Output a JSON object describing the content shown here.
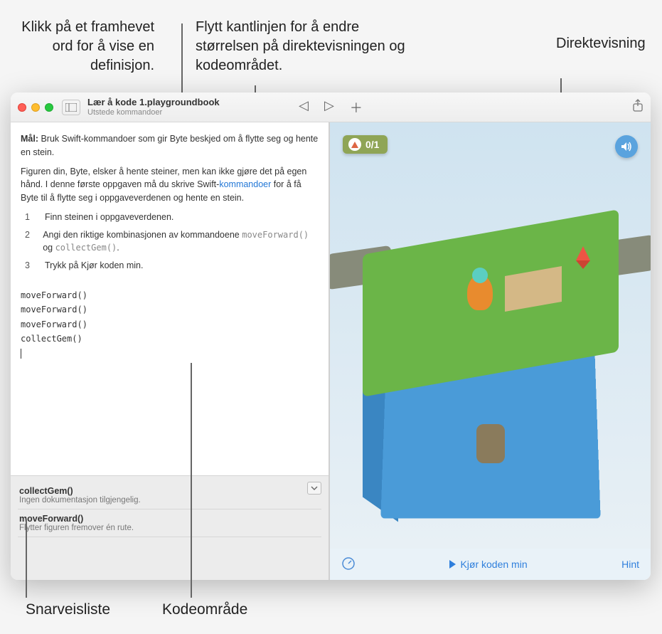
{
  "callouts": {
    "definition": "Klikk på et framhevet ord for å vise en definisjon.",
    "resize": "Flytt kantlinjen for å endre størrelsen på direktevisningen og kodeområdet.",
    "liveview": "Direktevisning",
    "shortcuts": "Snarveisliste",
    "codearea": "Kodeområde"
  },
  "window": {
    "title": "Lær å kode 1.playgroundbook",
    "subtitle": "Utstede kommandoer"
  },
  "instructions": {
    "goal_label": "Mål:",
    "goal_text": " Bruk Swift-kommandoer som gir Byte beskjed om å flytte seg og hente en stein.",
    "para1_a": "Figuren din, Byte, elsker å hente steiner, men kan ikke gjøre det på egen hånd. I denne første oppgaven må du skrive Swift-",
    "para1_link": "kommandoer",
    "para1_b": " for å få Byte til å flytte seg i oppgaveverdenen og hente en stein.",
    "steps": [
      {
        "num": "1",
        "text": "Finn steinen i oppgaveverdenen."
      },
      {
        "num": "2",
        "text_a": "Angi den riktige kombinasjonen av kommandoene ",
        "code1": "moveForward()",
        "mid": " og ",
        "code2": "collectGem()",
        "end": "."
      },
      {
        "num": "3",
        "text": "Trykk på Kjør koden min."
      }
    ]
  },
  "code_lines": [
    "moveForward()",
    "moveForward()",
    "moveForward()",
    "collectGem()"
  ],
  "shortcuts": [
    {
      "name": "collectGem()",
      "desc": "Ingen dokumentasjon tilgjengelig."
    },
    {
      "name": "moveForward()",
      "desc": "Flytter figuren fremover én rute."
    }
  ],
  "liveview": {
    "counter": "0/1",
    "run_label": "Kjør koden min",
    "hint_label": "Hint"
  },
  "icons": {
    "sound": "sound-icon",
    "share": "share-icon",
    "prev": "prev-icon",
    "next": "next-icon",
    "add": "add-icon",
    "sidebar": "sidebar-icon",
    "speed": "speed-icon",
    "dropdown": "dropdown-icon"
  }
}
